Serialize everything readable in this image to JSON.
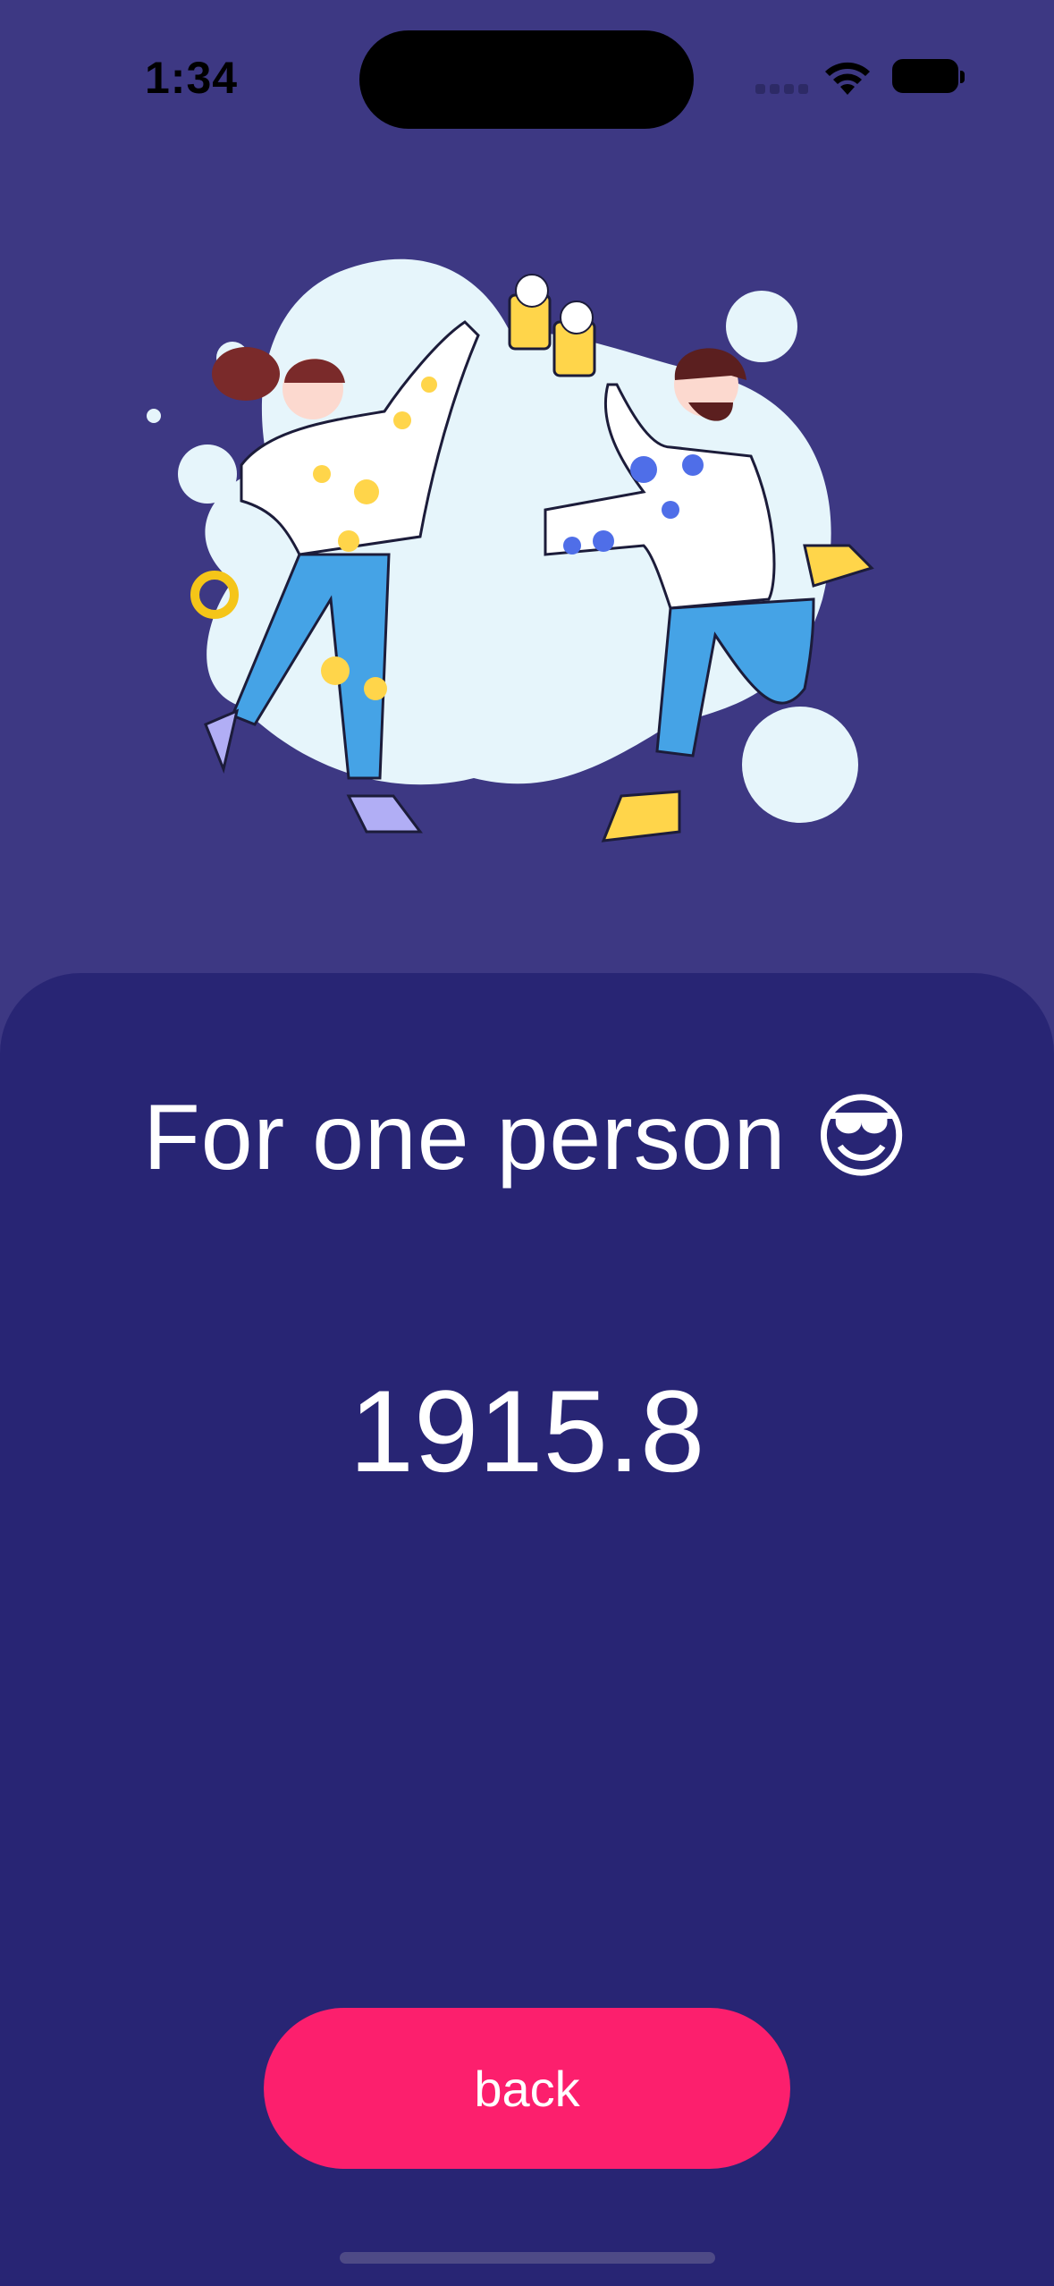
{
  "status": {
    "time": "1:34",
    "icons": [
      "cellular-signal-icon",
      "wifi-icon",
      "battery-icon"
    ]
  },
  "illustration": {
    "name": "people-toasting-beer-illustration"
  },
  "main": {
    "title": "For one person 😎",
    "result": "1915.8",
    "back_label": "back"
  },
  "colors": {
    "background_top": "#3d3883",
    "card": "#282574",
    "button": "#fc1f6d",
    "text": "#ffffff"
  }
}
